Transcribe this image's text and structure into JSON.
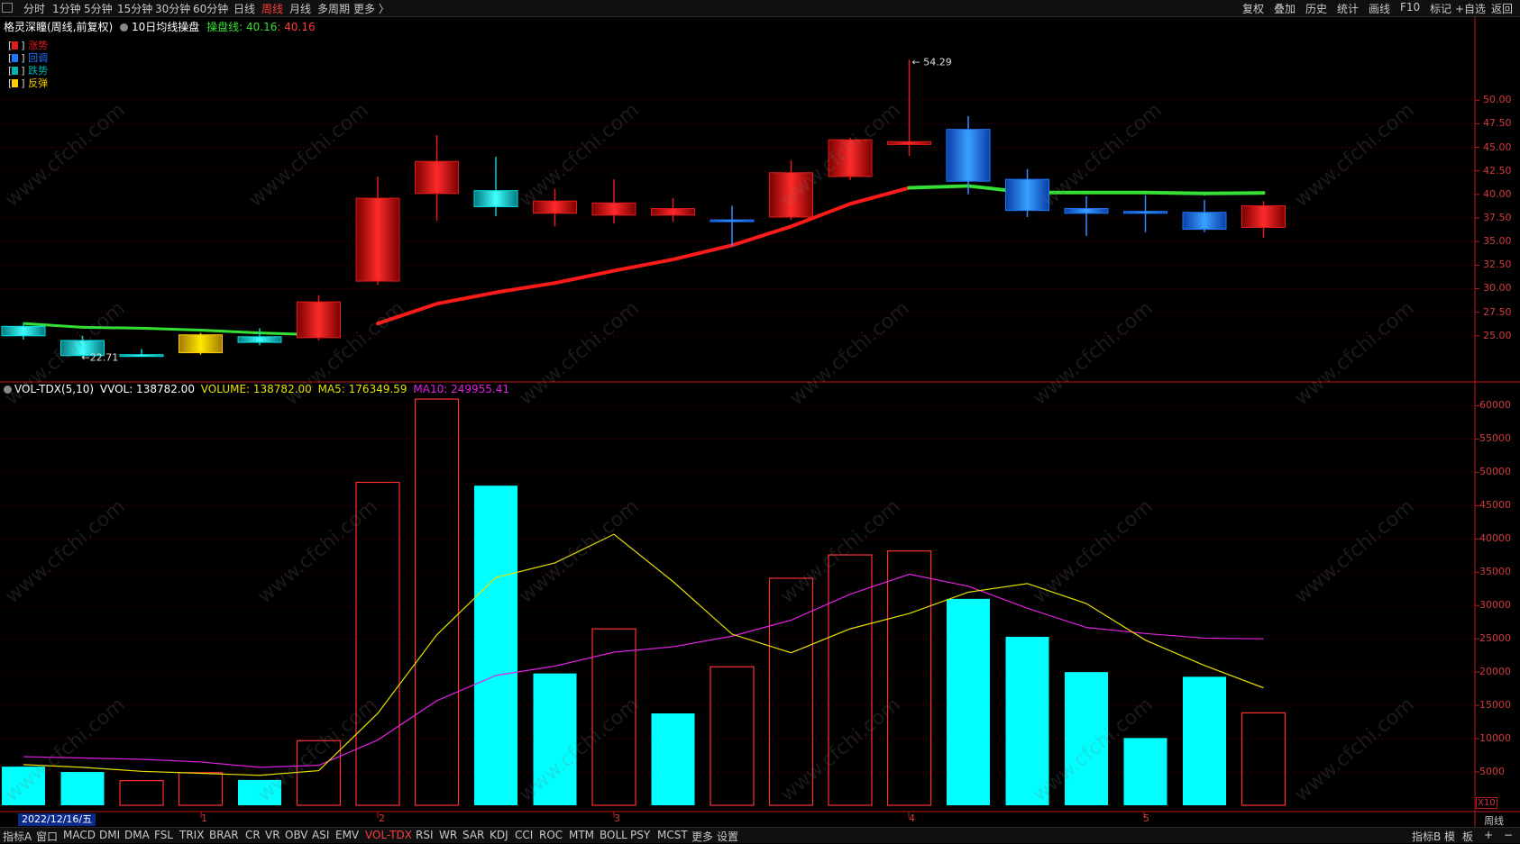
{
  "toolbar": {
    "periods": [
      "分时",
      "1分钟",
      "5分钟",
      "15分钟",
      "30分钟",
      "60分钟",
      "日线",
      "周线",
      "月线",
      "多周期",
      "更多 〉"
    ],
    "active_period": "周线",
    "right_buttons": [
      "复权",
      "叠加",
      "历史",
      "统计",
      "画线",
      "F10",
      "标记",
      "+自选",
      "返回"
    ]
  },
  "info": {
    "stock": "格灵深瞳(周线,前复权)",
    "indicator_name": "10日均线操盘",
    "line_label": "操盘线:",
    "value1": "40.16",
    "value2": "40.16"
  },
  "legend": [
    {
      "label": "涨势",
      "color": "#e21c1c"
    },
    {
      "label": "回调",
      "color": "#1e78ff"
    },
    {
      "label": "跌势",
      "color": "#00b4b4"
    },
    {
      "label": "反弹",
      "color": "#ffcc00"
    }
  ],
  "annotations": {
    "high": "54.29",
    "low": "22.71"
  },
  "price_axis": [
    "50.00",
    "47.50",
    "45.00",
    "42.50",
    "40.00",
    "37.50",
    "35.00",
    "32.50",
    "30.00",
    "27.50",
    "25.00"
  ],
  "vol_info": {
    "name": "VOL-TDX(5,10)",
    "vvol": "VVOL: 138782.00",
    "volume": "VOLUME: 138782.00",
    "ma5": "MA5: 176349.59",
    "ma10": "MA10: 249955.41"
  },
  "vol_axis": [
    "60000",
    "55000",
    "50000",
    "45000",
    "40000",
    "35000",
    "30000",
    "25000",
    "20000",
    "15000",
    "10000",
    "5000"
  ],
  "vol_axis_unit": "X10",
  "date_label": "2022/12/16/五",
  "x_marks": [
    "1",
    "2",
    "3",
    "4",
    "5"
  ],
  "period_corner": "周线",
  "bottom_tabs": [
    "指标A",
    "窗口",
    "MACD",
    "DMI",
    "DMA",
    "FSL",
    "TRIX",
    "BRAR",
    "CR",
    "VR",
    "OBV",
    "ASI",
    "EMV",
    "VOL-TDX",
    "RSI",
    "WR",
    "SAR",
    "KDJ",
    "CCI",
    "ROC",
    "MTM",
    "BOLL",
    "PSY",
    "MCST",
    "更多",
    "设置"
  ],
  "active_tab": "VOL-TDX",
  "bottom_right": [
    "指标B",
    "模",
    "板",
    "+",
    "−"
  ],
  "watermark_text": "www.cfchi.com",
  "colors": {
    "up": "#e21c1c",
    "pullback": "#1e78ff",
    "down": "#00e5e5",
    "rebound": "#ffcc00",
    "ma_up": "#ff1a1a",
    "ma_flat": "#33e033",
    "ma5": "#e6e000",
    "ma10": "#e020e0",
    "axis": "#c01818"
  },
  "chart_data": {
    "type": "candlestick",
    "candles": [
      {
        "o": 26.0,
        "c": 25.0,
        "h": 26.4,
        "l": 24.6,
        "s": "down"
      },
      {
        "o": 24.5,
        "c": 22.9,
        "h": 25.0,
        "l": 22.71,
        "s": "down"
      },
      {
        "o": 23.0,
        "c": 23.0,
        "h": 23.6,
        "l": 22.9,
        "s": "down"
      },
      {
        "o": 25.1,
        "c": 23.2,
        "h": 25.3,
        "l": 23.0,
        "s": "rebound"
      },
      {
        "o": 24.9,
        "c": 24.3,
        "h": 25.8,
        "l": 24.0,
        "s": "down"
      },
      {
        "o": 24.8,
        "c": 28.6,
        "h": 29.3,
        "l": 24.5,
        "s": "up"
      },
      {
        "o": 30.8,
        "c": 39.6,
        "h": 41.9,
        "l": 30.4,
        "s": "up"
      },
      {
        "o": 40.1,
        "c": 43.5,
        "h": 46.3,
        "l": 37.2,
        "s": "up"
      },
      {
        "o": 40.4,
        "c": 38.7,
        "h": 44.0,
        "l": 37.7,
        "s": "down"
      },
      {
        "o": 38.0,
        "c": 39.3,
        "h": 40.6,
        "l": 36.6,
        "s": "up"
      },
      {
        "o": 37.8,
        "c": 39.1,
        "h": 41.6,
        "l": 36.9,
        "s": "up"
      },
      {
        "o": 37.8,
        "c": 38.5,
        "h": 39.6,
        "l": 37.1,
        "s": "up"
      },
      {
        "o": 37.3,
        "c": 37.3,
        "h": 38.8,
        "l": 34.5,
        "s": "pullback"
      },
      {
        "o": 37.6,
        "c": 42.3,
        "h": 43.6,
        "l": 37.3,
        "s": "up"
      },
      {
        "o": 41.9,
        "c": 45.8,
        "h": 46.0,
        "l": 41.5,
        "s": "up"
      },
      {
        "o": 45.3,
        "c": 45.6,
        "h": 54.29,
        "l": 44.1,
        "s": "up"
      },
      {
        "o": 46.9,
        "c": 41.4,
        "h": 48.3,
        "l": 40.0,
        "s": "pullback"
      },
      {
        "o": 41.6,
        "c": 38.3,
        "h": 42.7,
        "l": 37.6,
        "s": "pullback"
      },
      {
        "o": 38.5,
        "c": 38.0,
        "h": 39.8,
        "l": 35.6,
        "s": "pullback"
      },
      {
        "o": 38.2,
        "c": 38.0,
        "h": 39.9,
        "l": 36.0,
        "s": "pullback"
      },
      {
        "o": 38.1,
        "c": 36.3,
        "h": 39.4,
        "l": 36.0,
        "s": "pullback"
      },
      {
        "o": 36.5,
        "c": 38.8,
        "h": 39.3,
        "l": 35.4,
        "s": "up"
      }
    ],
    "ma_line": [
      null,
      null,
      null,
      null,
      null,
      null,
      26.3,
      28.4,
      29.6,
      30.6,
      31.9,
      33.1,
      34.6,
      36.6,
      39.0,
      40.7,
      40.9,
      40.2,
      40.2,
      40.2,
      40.1,
      40.16
    ],
    "volume": [
      {
        "v": 5800,
        "hollow": false
      },
      {
        "v": 5000,
        "hollow": false
      },
      {
        "v": 3700,
        "hollow": true
      },
      {
        "v": 4900,
        "hollow": true
      },
      {
        "v": 3800,
        "hollow": false
      },
      {
        "v": 9700,
        "hollow": true
      },
      {
        "v": 48500,
        "hollow": true
      },
      {
        "v": 61000,
        "hollow": true
      },
      {
        "v": 48000,
        "hollow": false
      },
      {
        "v": 19800,
        "hollow": false
      },
      {
        "v": 26500,
        "hollow": true
      },
      {
        "v": 13800,
        "hollow": false
      },
      {
        "v": 20800,
        "hollow": true
      },
      {
        "v": 34100,
        "hollow": true
      },
      {
        "v": 37600,
        "hollow": true
      },
      {
        "v": 38200,
        "hollow": true
      },
      {
        "v": 31000,
        "hollow": false
      },
      {
        "v": 25300,
        "hollow": false
      },
      {
        "v": 20000,
        "hollow": false
      },
      {
        "v": 10100,
        "hollow": false
      },
      {
        "v": 19300,
        "hollow": false
      },
      {
        "v": 13878,
        "hollow": true
      }
    ],
    "ma5": [
      6100,
      5700,
      5100,
      4800,
      4500,
      5200,
      13800,
      25600,
      34200,
      36400,
      40700,
      33600,
      25700,
      22900,
      26500,
      28800,
      32000,
      33300,
      30300,
      24800,
      21000,
      17634
    ],
    "ma10": [
      7300,
      7100,
      6900,
      6500,
      5700,
      6000,
      9800,
      15700,
      19500,
      20900,
      23000,
      23800,
      25400,
      27800,
      31700,
      34700,
      32900,
      29600,
      26700,
      25800,
      25100,
      24996
    ],
    "price_axis_range": [
      20.2,
      57.0
    ],
    "vol_axis_range": [
      0,
      62500
    ]
  }
}
